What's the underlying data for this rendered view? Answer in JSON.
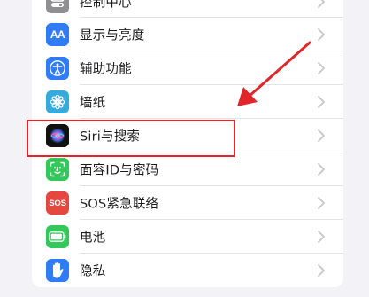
{
  "settings": {
    "items": [
      {
        "label": "控制中心",
        "icon": "control-center-icon",
        "color": "#8e8e93"
      },
      {
        "label": "显示与亮度",
        "icon": "display-brightness-icon",
        "color": "#2f7cf6"
      },
      {
        "label": "辅助功能",
        "icon": "accessibility-icon",
        "color": "#2f7cf6"
      },
      {
        "label": "墙纸",
        "icon": "wallpaper-icon",
        "color": "#35aadc"
      },
      {
        "label": "Siri与搜索",
        "icon": "siri-icon",
        "color": "#1c1c1e"
      },
      {
        "label": "面容ID与密码",
        "icon": "face-id-icon",
        "color": "#34c759"
      },
      {
        "label": "SOS紧急联络",
        "icon": "sos-icon",
        "color": "#e5483f"
      },
      {
        "label": "电池",
        "icon": "battery-icon",
        "color": "#34c759"
      },
      {
        "label": "隐私",
        "icon": "privacy-hand-icon",
        "color": "#2f7cf6"
      }
    ]
  },
  "icons": {
    "display_text": "AA",
    "sos_text": "SOS"
  },
  "annotation": {
    "highlight_color": "#e0262b",
    "target": "Siri与搜索"
  }
}
